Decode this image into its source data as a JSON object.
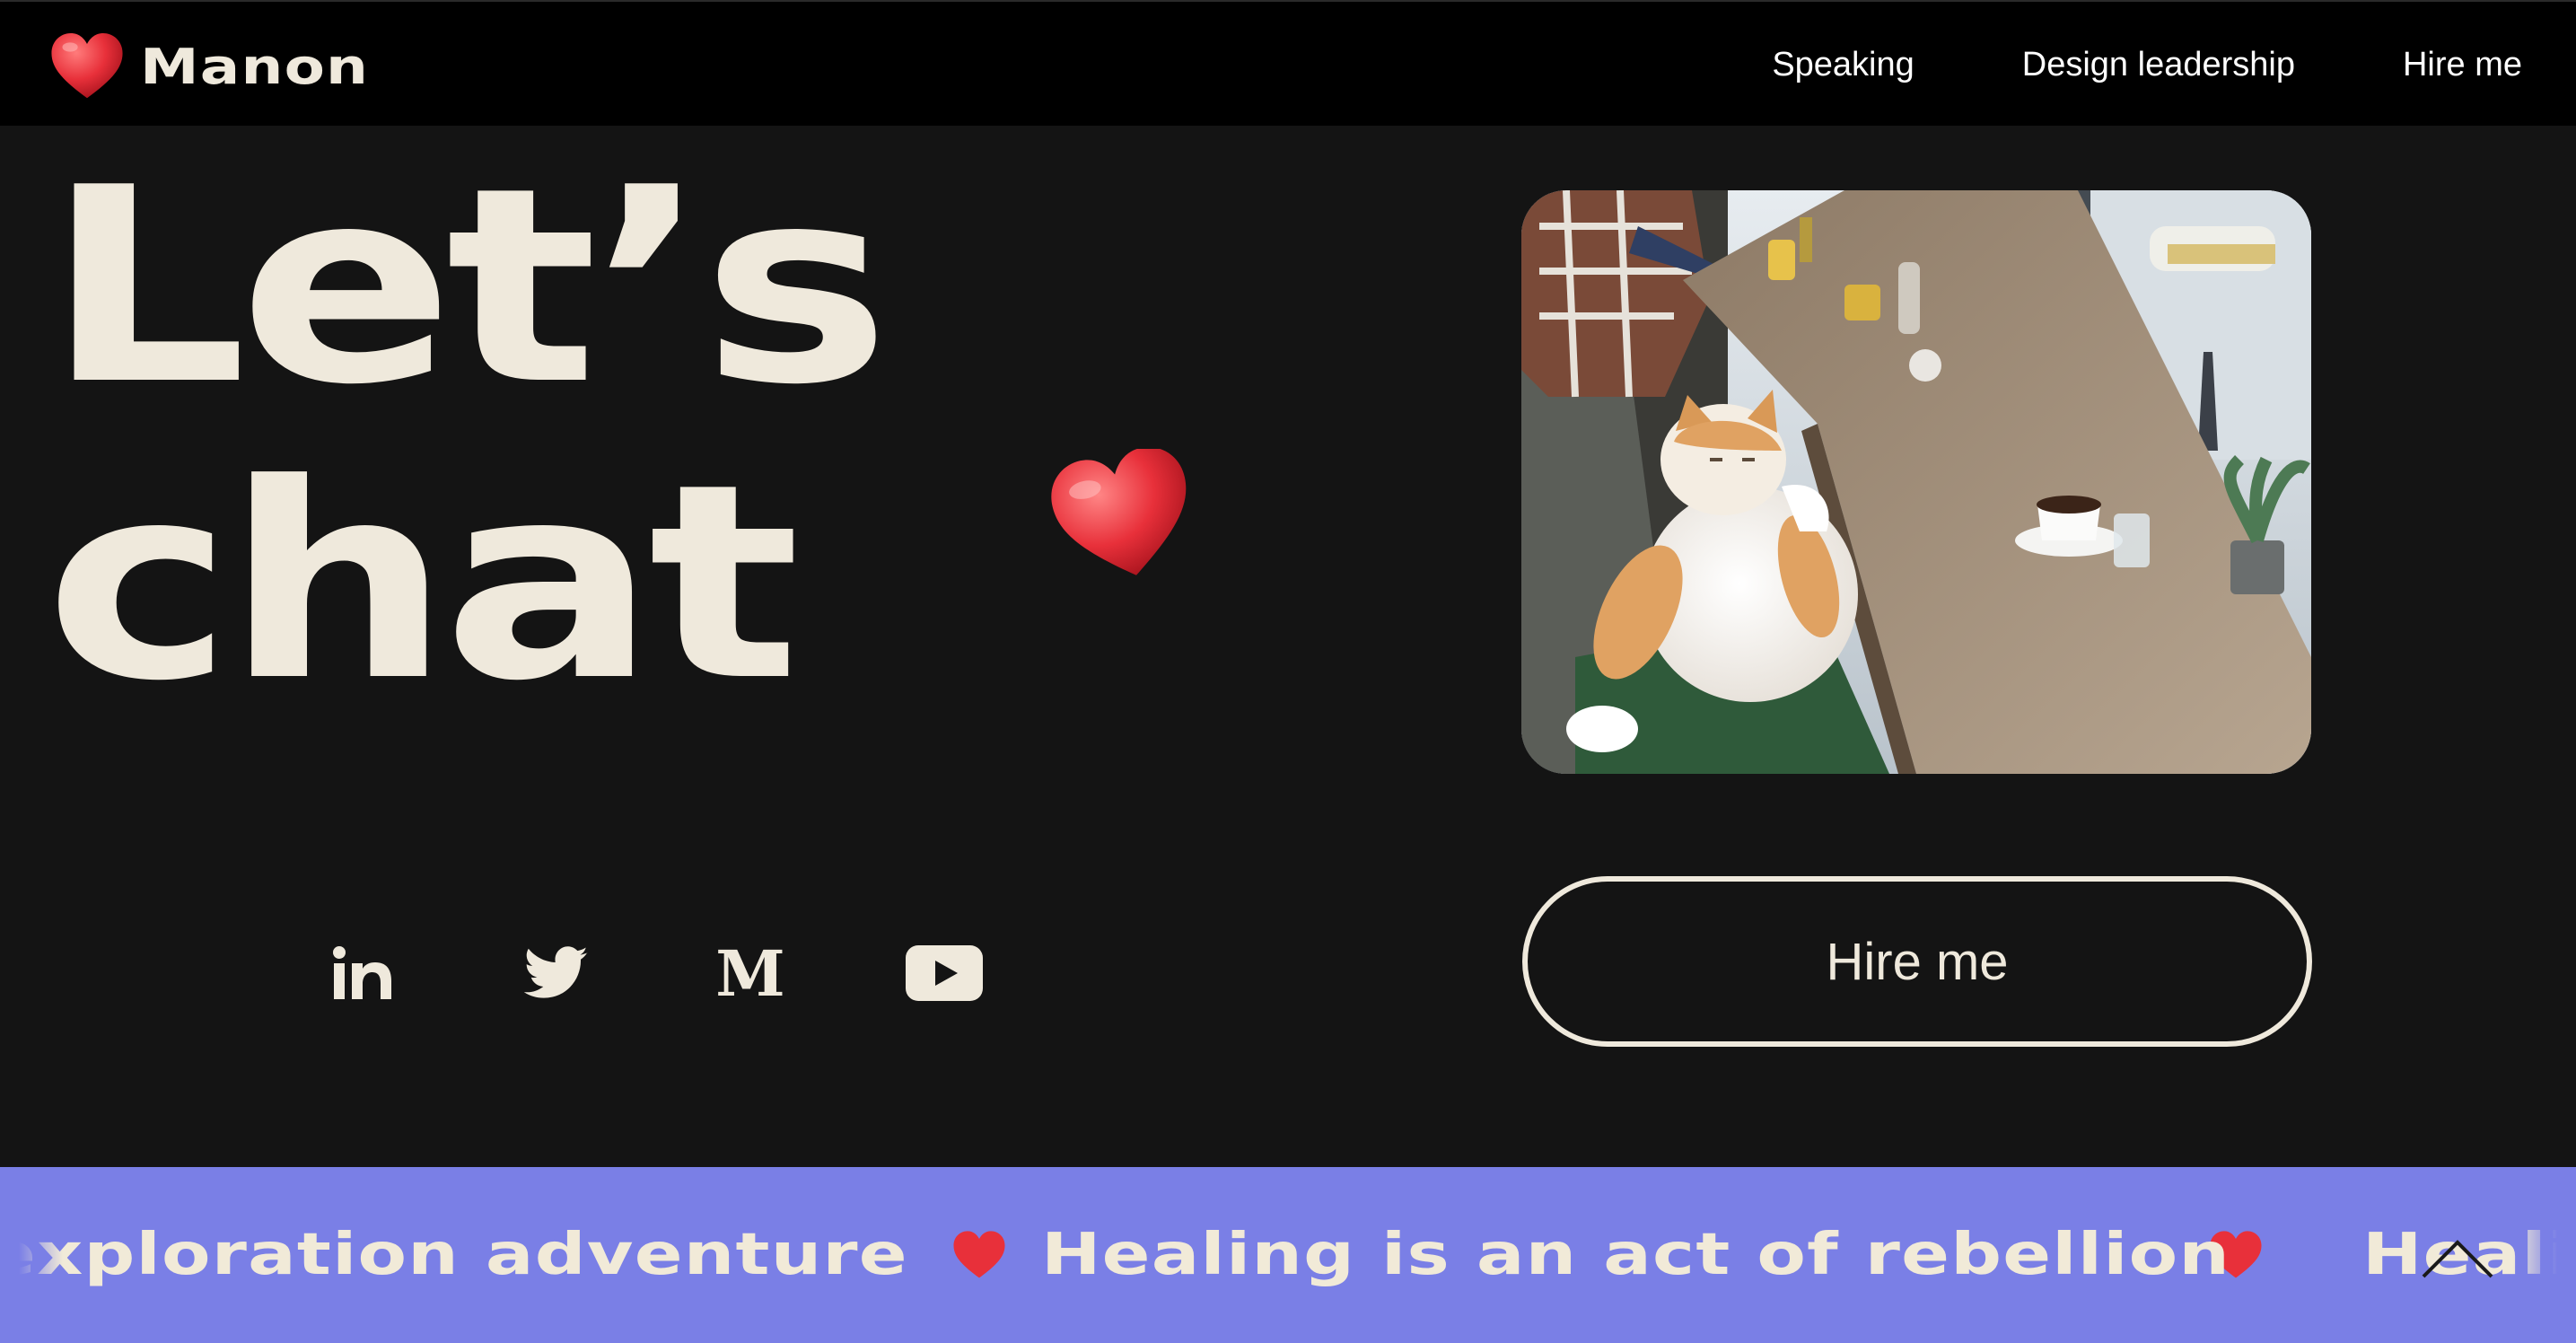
{
  "nav": {
    "brand": "Manon",
    "links": [
      "Speaking",
      "Design leadership",
      "Hire me"
    ]
  },
  "hero": {
    "line1": "Let’s",
    "line2": "chat"
  },
  "socials": [
    {
      "name": "linkedin-icon",
      "label": "LinkedIn"
    },
    {
      "name": "twitter-icon",
      "label": "Twitter"
    },
    {
      "name": "medium-icon",
      "label": "Medium"
    },
    {
      "name": "youtube-icon",
      "label": "YouTube"
    }
  ],
  "photo": {
    "description_icon": "cat-in-cafe-photo"
  },
  "cta": {
    "label": "Hire me"
  },
  "marquee": {
    "item1": "exploration adventure",
    "item2": "Healing is an act of rebellion",
    "item3": "Healing is an act of rebellion"
  },
  "colors": {
    "background": "#141414",
    "nav_background": "#000000",
    "text_cream": "#efe9dc",
    "marquee_background": "#7a7fe6",
    "heart_red": "#e8303a"
  }
}
